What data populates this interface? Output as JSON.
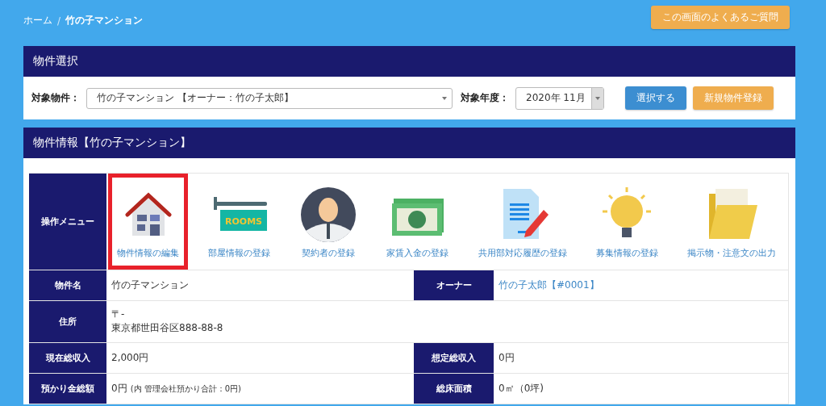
{
  "breadcrumb": [
    {
      "label": "ホーム",
      "current": false
    },
    {
      "label": "竹の子マンション",
      "current": true
    }
  ],
  "breadcrumb_separator": "/",
  "faq_button": "この画面のよくあるご質問",
  "property_select": {
    "title": "物件選択",
    "property_label": "対象物件：",
    "property_value": "竹の子マンション 【オーナー：竹の子太郎】",
    "year_label": "対象年度：",
    "year_value": "2020年 11月",
    "buttons": [
      {
        "label": "選択する",
        "kind": "primary"
      },
      {
        "label": "新規物件登録",
        "kind": "warning"
      }
    ]
  },
  "property_info": {
    "title": "物件情報【竹の子マンション】",
    "menu_label": "操作メニュー",
    "menu": [
      {
        "label": "物件情報の編集",
        "kind": "house",
        "selected": true
      },
      {
        "label": "部屋情報の登録",
        "kind": "sign",
        "sign_text": "ROOMS",
        "selected": false
      },
      {
        "label": "契約者の登録",
        "kind": "person",
        "selected": false
      },
      {
        "label": "家賃入金の登録",
        "kind": "money",
        "selected": false
      },
      {
        "label": "共用部対応履歴の登録",
        "kind": "document",
        "selected": false
      },
      {
        "label": "募集情報の登録",
        "kind": "bulb",
        "selected": false
      },
      {
        "label": "掲示物・注意文の出力",
        "kind": "folder",
        "selected": false
      }
    ],
    "rows": [
      {
        "cells": [
          {
            "label": "物件名",
            "lines": [
              "竹の子マンション"
            ]
          },
          {
            "label": "オーナー",
            "lines": [
              "竹の子太郎【#0001】"
            ],
            "link": true
          }
        ]
      },
      {
        "cells": [
          {
            "label": "住所",
            "lines": [
              "〒-",
              "東京都世田谷区888-88-8"
            ]
          }
        ]
      },
      {
        "cells": [
          {
            "label": "現在総収入",
            "lines": [
              "2,000円"
            ]
          },
          {
            "label": "想定総収入",
            "lines": [
              "0円"
            ]
          }
        ]
      },
      {
        "cells": [
          {
            "label": "預かり金総額",
            "lines": [
              "0円"
            ],
            "note": "(内 管理会社預かり合計：0円)"
          },
          {
            "label": "総床面積",
            "lines": [
              "0㎡（0坪)"
            ]
          }
        ]
      }
    ]
  }
}
